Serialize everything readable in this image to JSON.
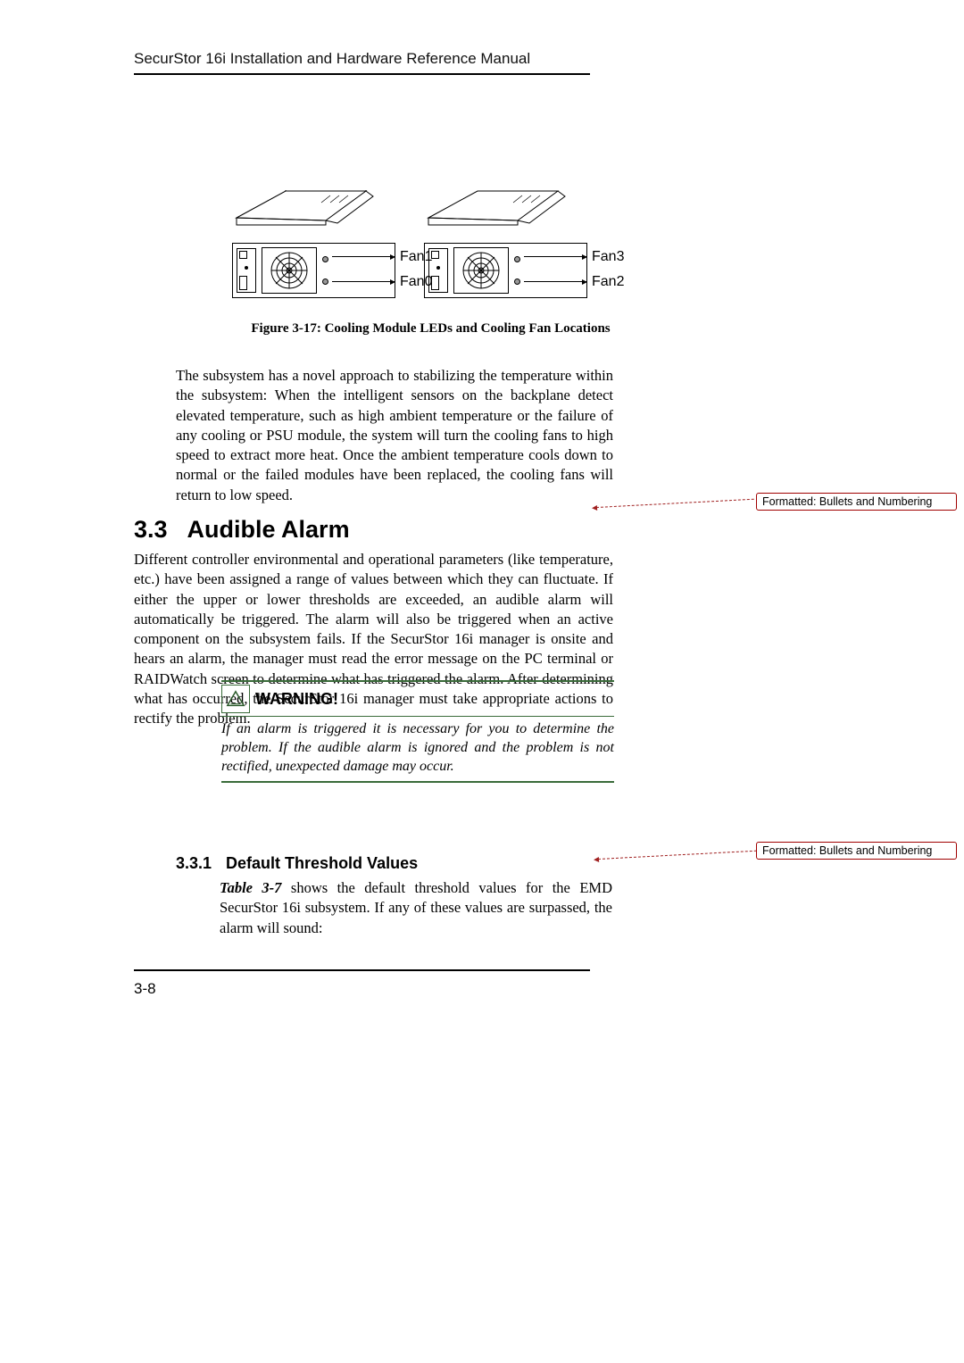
{
  "header": {
    "title": "SecurStor 16i Installation and Hardware Reference Manual"
  },
  "figure": {
    "caption": "Figure 3-17: Cooling Module LEDs and Cooling Fan Locations",
    "left_labels": {
      "top": "Fan1",
      "bottom": "Fan0"
    },
    "right_labels": {
      "top": "Fan3",
      "bottom": "Fan2"
    }
  },
  "para1": "The subsystem has a novel approach to stabilizing the temperature within the subsystem: When the intelligent sensors on the backplane detect elevated temperature, such as high ambient temperature or the failure of any cooling or PSU module, the system will turn the cooling fans to high speed to extract more heat. Once the ambient temperature cools down to normal or the failed modules have been replaced, the cooling fans will return to low speed.",
  "section33": {
    "number": "3.3",
    "title": "Audible Alarm",
    "body": "Different controller environmental and operational parameters (like temperature, etc.) have been assigned a range of values between which they can fluctuate. If either the upper or lower thresholds are exceeded, an audible alarm will automatically be triggered. The alarm will also be triggered when an active component on the subsystem fails. If the SecurStor 16i manager is onsite and hears an alarm, the manager must read the error message on the PC terminal or RAIDWatch screen to determine what has triggered the alarm. After determining what has occurred, the SecurStor 16i manager must take appropriate actions to rectify the problem."
  },
  "warning": {
    "label": "WARNING!",
    "text": "If an alarm is triggered it is necessary for you to determine the problem. If the audible alarm is ignored and the problem is not rectified, unexpected damage may occur."
  },
  "subsection331": {
    "number": "3.3.1",
    "title": "Default Threshold Values",
    "table_ref": "Table 3-7",
    "body_after": " shows the default threshold values for the EMD SecurStor 16i subsystem. If any of these values are surpassed, the alarm will sound:"
  },
  "footer": {
    "page": "3-8"
  },
  "callouts": {
    "c1": "Formatted: Bullets and Numbering",
    "c2": "Formatted: Bullets and Numbering"
  }
}
